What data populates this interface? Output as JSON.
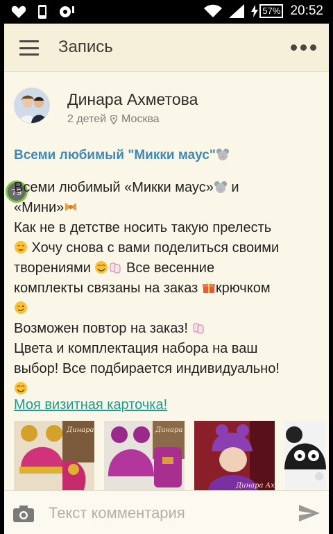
{
  "status_bar": {
    "battery": "57%",
    "time": "20:52"
  },
  "header": {
    "title": "Запись"
  },
  "post": {
    "author_name": "Динара Ахметова",
    "author_kids": "2 детей",
    "author_city": "Москва",
    "title": "Всеми любимый \"Микки маус\"",
    "badge_count": "79",
    "body": {
      "l1": "Всеми любимый «Микки маус»",
      "l1b": " и",
      "l2": "«Мини»",
      "l3": "Как не в детстве носить такую прелесть",
      "l4": " Хочу снова с вами поделиться своими",
      "l5": "творениями ",
      "l5b": " Все весенние",
      "l6": "комплекты связаны на заказ ",
      "l6b": "крючком",
      "l8": "Возможен повтор на заказ! ",
      "l9": "Цвета и комплектация набора на ваш",
      "l10": "выбор! Все подбирается индивидуально!"
    },
    "link": "Моя визитная карточка!",
    "photo_watermark": "Динара Ахметова"
  },
  "comment": {
    "placeholder": "Текст комментария"
  }
}
